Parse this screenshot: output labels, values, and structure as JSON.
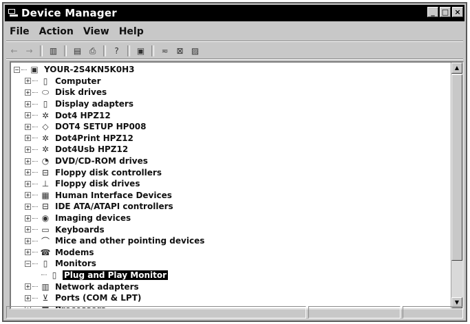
{
  "window": {
    "title": "Device Manager"
  },
  "menu": [
    "File",
    "Action",
    "View",
    "Help"
  ],
  "toolbar": [
    {
      "icon": "back-arrow-icon",
      "glyph": "←",
      "dim": true
    },
    {
      "icon": "forward-arrow-icon",
      "glyph": "→",
      "dim": true
    },
    {
      "sep": true
    },
    {
      "icon": "show-hide-tree-icon",
      "glyph": "▥"
    },
    {
      "sep": true
    },
    {
      "icon": "properties-icon",
      "glyph": "▤"
    },
    {
      "icon": "print-icon",
      "glyph": "⎙"
    },
    {
      "sep": true
    },
    {
      "icon": "help-icon",
      "glyph": "?"
    },
    {
      "sep": true
    },
    {
      "icon": "scan-hardware-icon",
      "glyph": "▣"
    },
    {
      "sep": true
    },
    {
      "icon": "update-driver-icon",
      "glyph": "≂"
    },
    {
      "icon": "uninstall-icon",
      "glyph": "⊠"
    },
    {
      "icon": "disable-icon",
      "glyph": "▨"
    }
  ],
  "tree": {
    "root": "YOUR-2S4KN5K0H3",
    "items": [
      {
        "label": "Computer",
        "icon": "computer-icon",
        "glyph": "▯"
      },
      {
        "label": "Disk drives",
        "icon": "disk-drive-icon",
        "glyph": "⬭"
      },
      {
        "label": "Display adapters",
        "icon": "display-adapter-icon",
        "glyph": "▯"
      },
      {
        "label": "Dot4 HPZ12",
        "icon": "device-icon",
        "glyph": "✲"
      },
      {
        "label": "DOT4 SETUP HP008",
        "icon": "setup-device-icon",
        "glyph": "◇"
      },
      {
        "label": "Dot4Print HPZ12",
        "icon": "device-icon",
        "glyph": "✲"
      },
      {
        "label": "Dot4Usb HPZ12",
        "icon": "device-icon",
        "glyph": "✲"
      },
      {
        "label": "DVD/CD-ROM drives",
        "icon": "cdrom-icon",
        "glyph": "◔"
      },
      {
        "label": "Floppy disk controllers",
        "icon": "controller-icon",
        "glyph": "⊟"
      },
      {
        "label": "Floppy disk drives",
        "icon": "floppy-icon",
        "glyph": "⊥"
      },
      {
        "label": "Human Interface Devices",
        "icon": "hid-icon",
        "glyph": "▦"
      },
      {
        "label": "IDE ATA/ATAPI controllers",
        "icon": "ide-controller-icon",
        "glyph": "⊟"
      },
      {
        "label": "Imaging devices",
        "icon": "camera-icon",
        "glyph": "◉"
      },
      {
        "label": "Keyboards",
        "icon": "keyboard-icon",
        "glyph": "▭"
      },
      {
        "label": "Mice and other pointing devices",
        "icon": "mouse-icon",
        "glyph": "⌒"
      },
      {
        "label": "Modems",
        "icon": "modem-icon",
        "glyph": "☎"
      },
      {
        "label": "Monitors",
        "icon": "monitor-icon",
        "glyph": "▯",
        "expanded": true
      },
      {
        "label": "Plug and Play Monitor",
        "icon": "monitor-icon",
        "glyph": "▯",
        "leaf": true,
        "selected": true
      },
      {
        "label": "Network adapters",
        "icon": "network-adapter-icon",
        "glyph": "▥"
      },
      {
        "label": "Ports (COM & LPT)",
        "icon": "port-icon",
        "glyph": "⊻"
      },
      {
        "label": "Processors",
        "icon": "processor-icon",
        "glyph": "■"
      }
    ]
  },
  "colors": {
    "selection_bg": "#000000",
    "selection_fg": "#ffffff",
    "titlebar": "#000000"
  }
}
